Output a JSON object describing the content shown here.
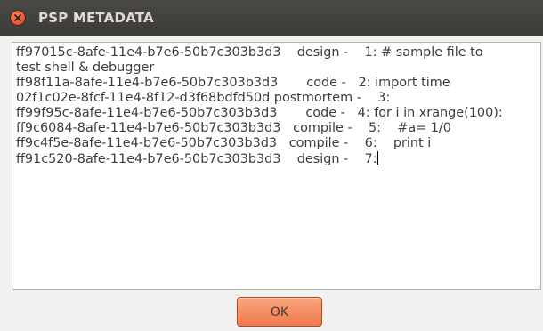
{
  "window": {
    "title": "PSP METADATA",
    "close_icon": "close-icon"
  },
  "content": {
    "lines": [
      "ff97015c-8afe-11e4-b7e6-50b7c303b3d3    design -    1: # sample file to",
      "test shell & debugger",
      "ff98f11a-8afe-11e4-b7e6-50b7c303b3d3       code -   2: import time",
      "02f1c02e-8fcf-11e4-8f12-d3f68bdfd50d postmortem -    3:",
      "ff99f95c-8afe-11e4-b7e6-50b7c303b3d3       code -   4: for i in xrange(100):",
      "ff9c6084-8afe-11e4-b7e6-50b7c303b3d3   compile -    5:    #a= 1/0",
      "ff9c4f5e-8afe-11e4-b7e6-50b7c303b3d3   compile -    6:    print i",
      "ff91c520-8afe-11e4-b7e6-50b7c303b3d3    design -    7:"
    ]
  },
  "buttons": {
    "ok_label": "OK"
  },
  "colors": {
    "titlebar": "#3c3b37",
    "accent": "#ef7a4b",
    "close": "#e0502a"
  }
}
